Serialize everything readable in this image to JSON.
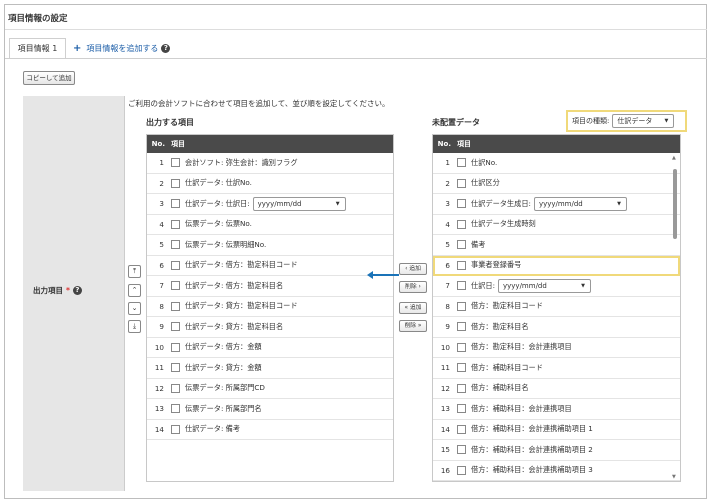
{
  "page": {
    "title": "項目情報の設定"
  },
  "tabs": {
    "active_label": "項目情報 1",
    "add_label": "項目情報を追加する",
    "add_symbol": "+",
    "help_symbol": "?"
  },
  "toolbar": {
    "copy_label": "コピーして追加"
  },
  "field": {
    "label": "出力項目",
    "required_mark": "*",
    "help_symbol": "?"
  },
  "intro": "ご利用の会計ソフトに合わせて項目を追加して、並び順を設定してください。",
  "output": {
    "title": "出力する項目",
    "col_no": "No.",
    "col_item": "項目",
    "rows": [
      {
        "no": "1",
        "label": "会計ソフト: 弥生会計：識別フラグ"
      },
      {
        "no": "2",
        "label": "仕訳データ: 仕訳No."
      },
      {
        "no": "3",
        "label": "仕訳データ: 仕訳日:",
        "select": "yyyy/mm/dd"
      },
      {
        "no": "4",
        "label": "伝票データ: 伝票No."
      },
      {
        "no": "5",
        "label": "伝票データ: 伝票明細No."
      },
      {
        "no": "6",
        "label": "仕訳データ: 借方：勘定科目コード"
      },
      {
        "no": "7",
        "label": "仕訳データ: 借方：勘定科目名"
      },
      {
        "no": "8",
        "label": "仕訳データ: 貸方：勘定科目コード"
      },
      {
        "no": "9",
        "label": "仕訳データ: 貸方：勘定科目名"
      },
      {
        "no": "10",
        "label": "仕訳データ: 借方：金額"
      },
      {
        "no": "11",
        "label": "仕訳データ: 貸方：金額"
      },
      {
        "no": "12",
        "label": "伝票データ: 所属部門CD"
      },
      {
        "no": "13",
        "label": "伝票データ: 所属部門名"
      },
      {
        "no": "14",
        "label": "仕訳データ: 備考"
      }
    ]
  },
  "move": {
    "top": "⤒",
    "up": "⌃",
    "down": "⌄",
    "bottom": "⤓"
  },
  "mid": {
    "add": "‹ 追加",
    "remove": "削除 ›",
    "add_all": "« 追加",
    "remove_all": "削除 »"
  },
  "unplaced": {
    "title": "未配置データ",
    "type_label": "項目の種類:",
    "type_value": "仕訳データ",
    "col_no": "No.",
    "col_item": "項目",
    "rows": [
      {
        "no": "1",
        "label": "仕訳No."
      },
      {
        "no": "2",
        "label": "仕訳区分"
      },
      {
        "no": "3",
        "label": "仕訳データ生成日:",
        "select": "yyyy/mm/dd"
      },
      {
        "no": "4",
        "label": "仕訳データ生成時刻"
      },
      {
        "no": "5",
        "label": "備考"
      },
      {
        "no": "6",
        "label": "事業者登録番号",
        "highlight": true
      },
      {
        "no": "7",
        "label": "仕訳日:",
        "select": "yyyy/mm/dd"
      },
      {
        "no": "8",
        "label": "借方：勘定科目コード"
      },
      {
        "no": "9",
        "label": "借方：勘定科目名"
      },
      {
        "no": "10",
        "label": "借方：勘定科目：会計連携項目"
      },
      {
        "no": "11",
        "label": "借方：補助科目コード"
      },
      {
        "no": "12",
        "label": "借方：補助科目名"
      },
      {
        "no": "13",
        "label": "借方：補助科目：会計連携項目"
      },
      {
        "no": "14",
        "label": "借方：補助科目：会計連携補助項目 1"
      },
      {
        "no": "15",
        "label": "借方：補助科目：会計連携補助項目 2"
      },
      {
        "no": "16",
        "label": "借方：補助科目：会計連携補助項目 3"
      }
    ]
  },
  "colors": {
    "highlight": "#f0d97a",
    "link": "#1e5fa8",
    "arrow": "#1a73b8",
    "header_bg": "#4a4a4a",
    "label_bg": "#e6e6e6"
  }
}
